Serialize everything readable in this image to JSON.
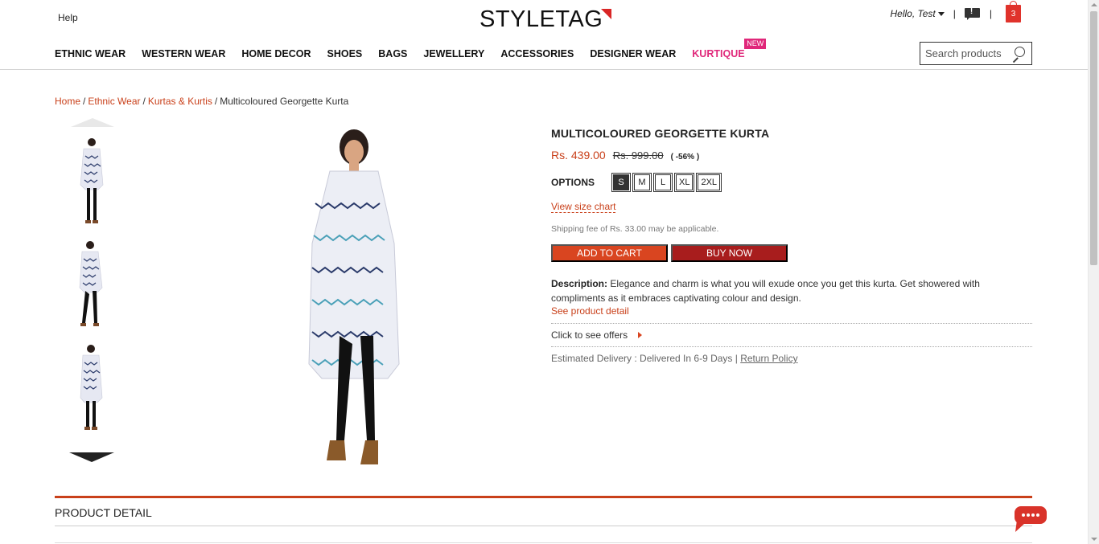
{
  "header": {
    "help": "Help",
    "logo": "STYLETAG",
    "hello": "Hello, Test",
    "sep1": "|",
    "sep2": "|",
    "cart_count": "3"
  },
  "nav": {
    "items": [
      "ETHNIC WEAR",
      "WESTERN WEAR",
      "HOME DECOR",
      "SHOES",
      "BAGS",
      "JEWELLERY",
      "ACCESSORIES",
      "DESIGNER WEAR"
    ],
    "kurtique": "KURTIQUE",
    "new_badge": "NEW"
  },
  "search": {
    "placeholder": "Search products"
  },
  "breadcrumb": {
    "home": "Home",
    "ethnic": "Ethnic Wear",
    "kurtas": "Kurtas & Kurtis",
    "current": "Multicoloured Georgette Kurta",
    "sep": "/"
  },
  "product": {
    "title": "MULTICOLOURED GEORGETTE KURTA",
    "price": "Rs. 439.00",
    "old_price": "Rs. 999.00",
    "discount": "( -56% )",
    "options_label": "OPTIONS",
    "sizes": [
      "S",
      "M",
      "L",
      "XL",
      "2XL"
    ],
    "selected_size": "S",
    "size_chart": "View size chart",
    "shipping": "Shipping fee of Rs. 33.00 may be applicable.",
    "add_to_cart": "ADD TO CART",
    "buy_now": "BUY NOW",
    "desc_label": "Description:",
    "desc_text": " Elegance and charm is what you will exude once you get this kurta. Get showered with compliments as it embraces captivating colour and design.",
    "see_detail": "See product detail",
    "offers": "Click to see offers",
    "delivery": "Estimated Delivery : Delivered In 6-9 Days | ",
    "return_policy": "Return Policy"
  },
  "section": {
    "detail_title": "PRODUCT DETAIL"
  },
  "colors": {
    "accent": "#c9401a",
    "buy": "#a81d1d",
    "kurtique": "#e0287a"
  }
}
